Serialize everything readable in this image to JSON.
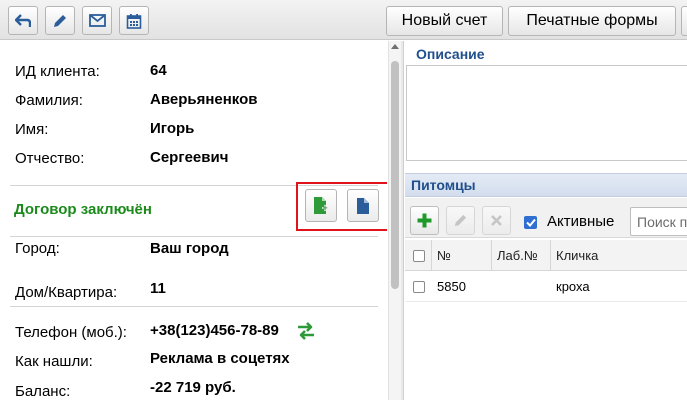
{
  "toolbar": {
    "back_icon": "back-arrow-icon",
    "edit_icon": "pencil-icon",
    "mail_icon": "envelope-icon",
    "calendar_icon": "calendar-icon",
    "new_invoice_label": "Новый счет",
    "print_forms_label": "Печатные формы"
  },
  "client": {
    "fields": [
      {
        "label": "ИД клиента:",
        "value": "64"
      },
      {
        "label": "Фамилия:",
        "value": "Аверьяненков"
      },
      {
        "label": "Имя:",
        "value": "Игорь"
      },
      {
        "label": "Отчество:",
        "value": "Сергеевич"
      }
    ],
    "contract_status": "Договор заключён",
    "contract_status_color": "#1b8a1b",
    "address": [
      {
        "label": "Город:",
        "value": "Ваш город"
      },
      {
        "label": "Дом/Квартира:",
        "value": "11"
      }
    ],
    "contacts": [
      {
        "label": "Телефон (моб.):",
        "value": "+38(123)456-78-89"
      },
      {
        "label": "Как нашли:",
        "value": "Реклама в соцетях"
      },
      {
        "label": "Баланс:",
        "value": "-22 719 руб."
      }
    ]
  },
  "description": {
    "title": "Описание",
    "value": ""
  },
  "pets": {
    "title": "Питомцы",
    "active_label": "Активные",
    "active_checked": true,
    "search_placeholder": "Поиск п",
    "columns": [
      "№",
      "Лаб.№",
      "Кличка"
    ],
    "rows": [
      {
        "number": "5850",
        "lab_number": "",
        "name": "кроха"
      }
    ]
  },
  "colors": {
    "accent_blue": "#1f4f8c",
    "highlight_red": "#e0121b",
    "add_green": "#1f9a2a"
  }
}
